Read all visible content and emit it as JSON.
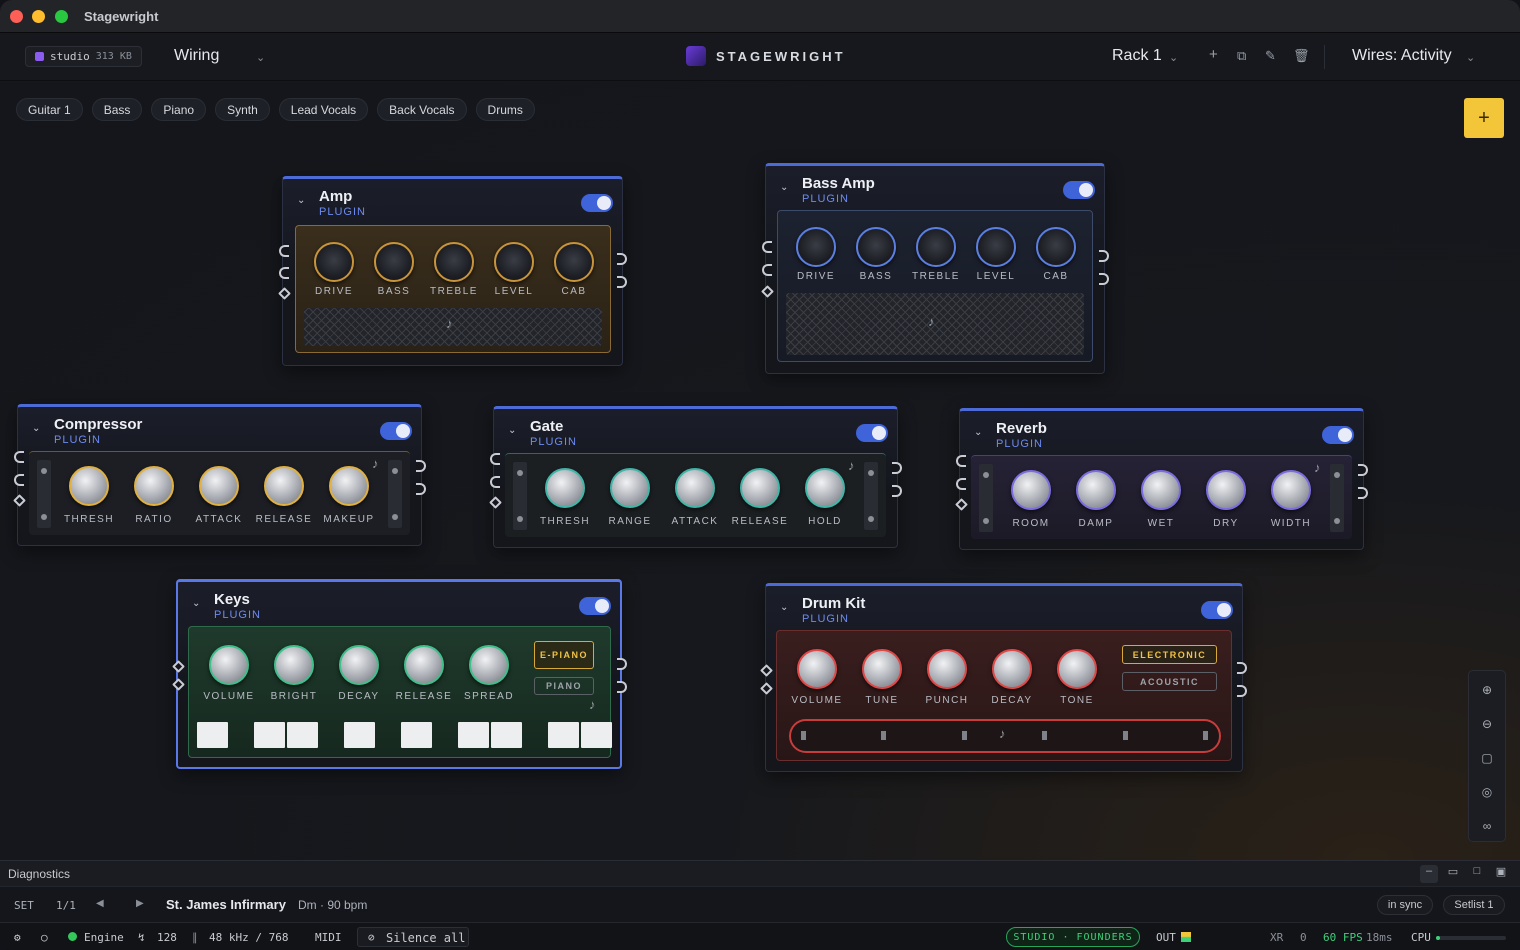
{
  "window": {
    "title": "Stagewright"
  },
  "toolbar": {
    "studio_name": "studio",
    "studio_size": "313 KB",
    "view": "Wiring",
    "brand": "STAGEWRIGHT",
    "rack": "Rack 1",
    "wires": "Wires: Activity"
  },
  "tabs": [
    "Guitar 1",
    "Bass",
    "Piano",
    "Synth",
    "Lead Vocals",
    "Back Vocals",
    "Drums"
  ],
  "plugins": {
    "amp": {
      "name": "Amp",
      "type": "PLUGIN",
      "knobs": [
        "DRIVE",
        "BASS",
        "TREBLE",
        "LEVEL",
        "CAB"
      ],
      "enabled": true,
      "accent": "#c8943a"
    },
    "bass_amp": {
      "name": "Bass Amp",
      "type": "PLUGIN",
      "knobs": [
        "DRIVE",
        "BASS",
        "TREBLE",
        "LEVEL",
        "CAB"
      ],
      "enabled": true,
      "accent": "#5b7fe0"
    },
    "compressor": {
      "name": "Compressor",
      "type": "PLUGIN",
      "knobs": [
        "THRESH",
        "RATIO",
        "ATTACK",
        "RELEASE",
        "MAKEUP"
      ],
      "enabled": true,
      "accent": "#e0b040"
    },
    "gate": {
      "name": "Gate",
      "type": "PLUGIN",
      "knobs": [
        "THRESH",
        "RANGE",
        "ATTACK",
        "RELEASE",
        "HOLD"
      ],
      "enabled": true,
      "accent": "#3fb6a8"
    },
    "reverb": {
      "name": "Reverb",
      "type": "PLUGIN",
      "knobs": [
        "ROOM",
        "DAMP",
        "WET",
        "DRY",
        "WIDTH"
      ],
      "enabled": true,
      "accent": "#7b6de0"
    },
    "keys": {
      "name": "Keys",
      "type": "PLUGIN",
      "knobs": [
        "VOLUME",
        "BRIGHT",
        "DECAY",
        "RELEASE",
        "SPREAD"
      ],
      "modes": [
        "E-PIANO",
        "PIANO"
      ],
      "enabled": true,
      "accent": "#3fc08a"
    },
    "drum_kit": {
      "name": "Drum Kit",
      "type": "PLUGIN",
      "knobs": [
        "VOLUME",
        "TUNE",
        "PUNCH",
        "DECAY",
        "TONE"
      ],
      "modes": [
        "ELECTRONIC",
        "ACOUSTIC"
      ],
      "enabled": true,
      "accent": "#e04848"
    }
  },
  "diagnostics": {
    "title": "Diagnostics"
  },
  "setbar": {
    "set_label": "SET",
    "set_pos": "1/1",
    "song": "St. James Infirmary",
    "song_meta": "Dm · 90 bpm",
    "sync": "in sync",
    "setlist": "Setlist 1"
  },
  "status": {
    "engine": "Engine",
    "buffer": "128",
    "rate": "48 kHz / 768",
    "midi": "MIDI",
    "silence": "Silence all",
    "license": "STUDIO · FOUNDERS",
    "out": "OUT",
    "xr_label": "XR",
    "xr_value": "0",
    "fps": "60 FPS",
    "latency": "18ms",
    "cpu": "CPU"
  }
}
